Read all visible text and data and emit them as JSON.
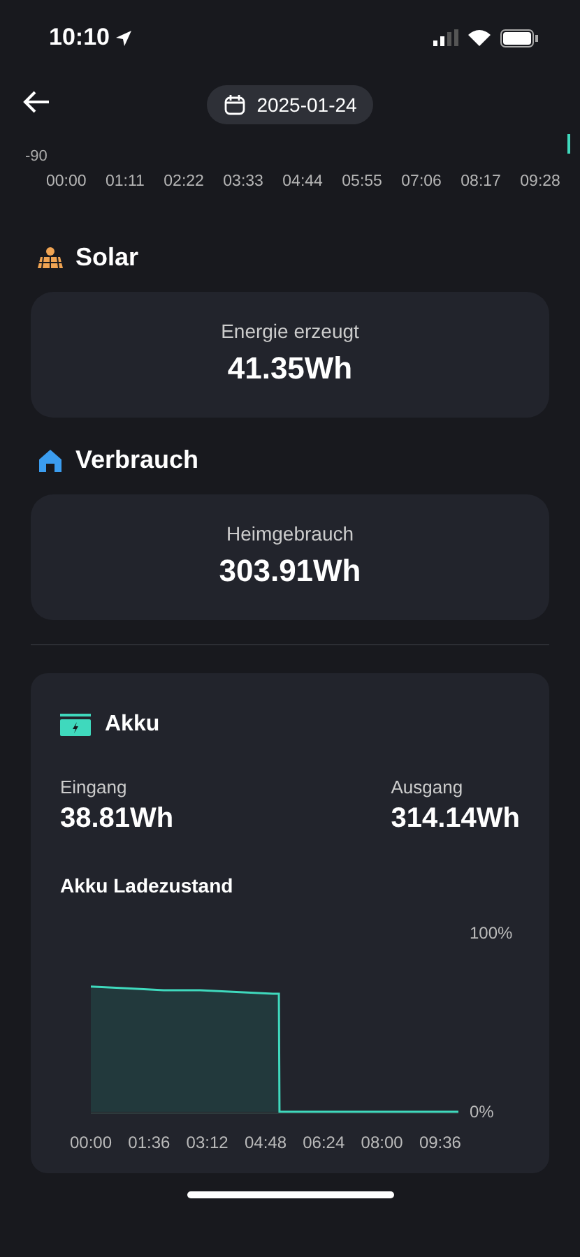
{
  "status_bar": {
    "time": "10:10"
  },
  "nav": {
    "date": "2025-01-24"
  },
  "top_chart": {
    "y_tick": "-90",
    "x_labels": [
      "00:00",
      "01:11",
      "02:22",
      "03:33",
      "04:44",
      "05:55",
      "07:06",
      "08:17",
      "09:28"
    ]
  },
  "sections": [
    {
      "kind": "solar",
      "title": "Solar",
      "label": "Energie erzeugt",
      "value": "41.35Wh"
    },
    {
      "kind": "home",
      "title": "Verbrauch",
      "label": "Heimgebrauch",
      "value": "303.91Wh"
    }
  ],
  "battery": {
    "title": "Akku",
    "stats": [
      {
        "label": "Eingang",
        "value": "38.81Wh"
      },
      {
        "label": "Ausgang",
        "value": "314.14Wh"
      }
    ],
    "chart_title": "Akku Ladezustand",
    "chart_data": {
      "type": "area",
      "x": [
        0,
        60,
        120,
        180,
        240,
        300,
        310,
        311,
        400,
        500,
        606
      ],
      "series": [
        {
          "color": "#3fd9bd",
          "values": [
            70,
            69,
            68,
            68,
            67,
            66,
            66,
            0,
            0,
            0,
            0
          ]
        }
      ],
      "xlim": [
        0,
        606
      ],
      "ylim": [
        0,
        100
      ],
      "xticks": [
        {
          "value": 0,
          "label": "00:00"
        },
        {
          "value": 96,
          "label": "01:36"
        },
        {
          "value": 192,
          "label": "03:12"
        },
        {
          "value": 288,
          "label": "04:48"
        },
        {
          "value": 384,
          "label": "06:24"
        },
        {
          "value": 480,
          "label": "08:00"
        },
        {
          "value": 576,
          "label": "09:36"
        }
      ],
      "yticks": [
        {
          "value": 0,
          "label": "0%"
        },
        {
          "value": 100,
          "label": "100%"
        }
      ]
    }
  }
}
